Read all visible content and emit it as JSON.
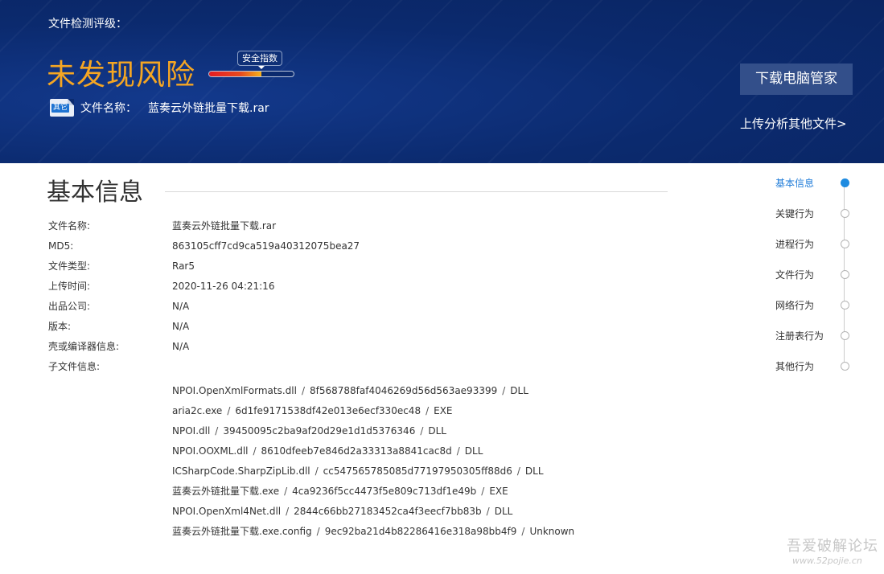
{
  "header": {
    "grade_label": "文件检测评级：",
    "verdict": "未发现风险",
    "verdict_color": "#f5a623",
    "safety_index_label": "安全指数",
    "safety_index_fill": 0.62,
    "file_icon_badge": "其它",
    "file_name_label": "文件名称：",
    "file_name": "蓝奏云外链批量下载.rar",
    "download_button": "下载电脑管家",
    "upload_link": "上传分析其他文件>"
  },
  "basic_info": {
    "title": "基本信息",
    "rows": [
      {
        "label": "文件名称:",
        "value": "蓝奏云外链批量下载.rar"
      },
      {
        "label": "MD5:",
        "value": "863105cff7cd9ca519a40312075bea27"
      },
      {
        "label": "文件类型:",
        "value": "Rar5"
      },
      {
        "label": "上传时间:",
        "value": "2020-11-26 04:21:16"
      },
      {
        "label": "出品公司:",
        "value": "N/A"
      },
      {
        "label": "版本:",
        "value": "N/A"
      },
      {
        "label": "壳或编译器信息:",
        "value": "N/A"
      },
      {
        "label": "子文件信息:",
        "value": ""
      }
    ],
    "sub_files": [
      {
        "name": "NPOI.OpenXmlFormats.dll",
        "hash": "8f568788faf4046269d56d563ae93399",
        "type": "DLL"
      },
      {
        "name": "aria2c.exe",
        "hash": "6d1fe9171538df42e013e6ecf330ec48",
        "type": "EXE"
      },
      {
        "name": "NPOI.dll",
        "hash": "39450095c2ba9af20d29e1d1d5376346",
        "type": "DLL"
      },
      {
        "name": "NPOI.OOXML.dll",
        "hash": "8610dfeeb7e846d2a33313a8841cac8d",
        "type": "DLL"
      },
      {
        "name": "ICSharpCode.SharpZipLib.dll",
        "hash": "cc547565785085d77197950305ff88d6",
        "type": "DLL"
      },
      {
        "name": "蓝奏云外链批量下载.exe",
        "hash": "4ca9236f5cc4473f5e809c713df1e49b",
        "type": "EXE"
      },
      {
        "name": "NPOI.OpenXml4Net.dll",
        "hash": "2844c66bb27183452ca4f3eecf7bb83b",
        "type": "DLL"
      },
      {
        "name": "蓝奏云外链批量下载.exe.config",
        "hash": "9ec92ba21d4b82286416e318a98bb4f9",
        "type": "Unknown"
      }
    ],
    "separator": "/"
  },
  "nav": {
    "active_color": "#1e7bd8",
    "items": [
      {
        "label": "基本信息",
        "active": true
      },
      {
        "label": "关键行为",
        "active": false
      },
      {
        "label": "进程行为",
        "active": false
      },
      {
        "label": "文件行为",
        "active": false
      },
      {
        "label": "网络行为",
        "active": false
      },
      {
        "label": "注册表行为",
        "active": false
      },
      {
        "label": "其他行为",
        "active": false
      }
    ]
  },
  "watermark": {
    "site_name": "吾爱破解论坛",
    "url": "www.52pojie.cn"
  }
}
